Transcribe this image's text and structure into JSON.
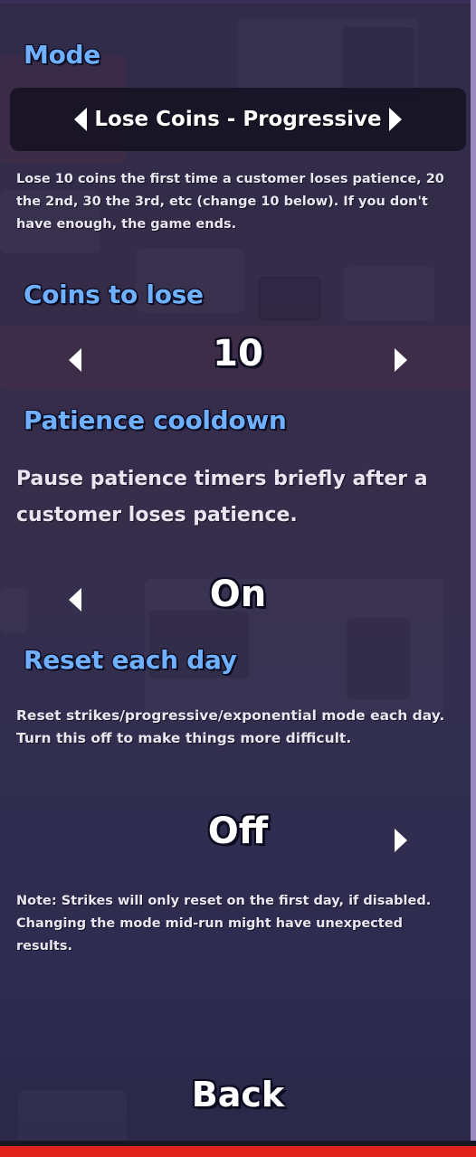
{
  "mode": {
    "heading": "Mode",
    "value": "Lose Coins - Progressive",
    "description": "Lose 10 coins the first time a customer loses patience, 20 the 2nd, 30 the 3rd, etc (change 10 below). If you don't have enough, the game ends."
  },
  "coins_to_lose": {
    "heading": "Coins to lose",
    "value": "10"
  },
  "patience_cooldown": {
    "heading": "Patience cooldown",
    "description": "Pause patience timers briefly after a customer loses patience.",
    "value": "On"
  },
  "reset_each_day": {
    "heading": "Reset each day",
    "description": "Reset strikes/progressive/exponential mode each day. Turn this off to make things more difficult.",
    "value": "Off"
  },
  "note": "Note: Strikes will only reset on the first day, if disabled. Changing the mode mid-run might have unexpected results.",
  "back_label": "Back",
  "colors": {
    "heading": "#6fb0ff",
    "text": "#e9e6f2",
    "bottom_bar": "#e0231b"
  },
  "icons": {
    "left": "arrow-left-icon",
    "right": "arrow-right-icon"
  }
}
